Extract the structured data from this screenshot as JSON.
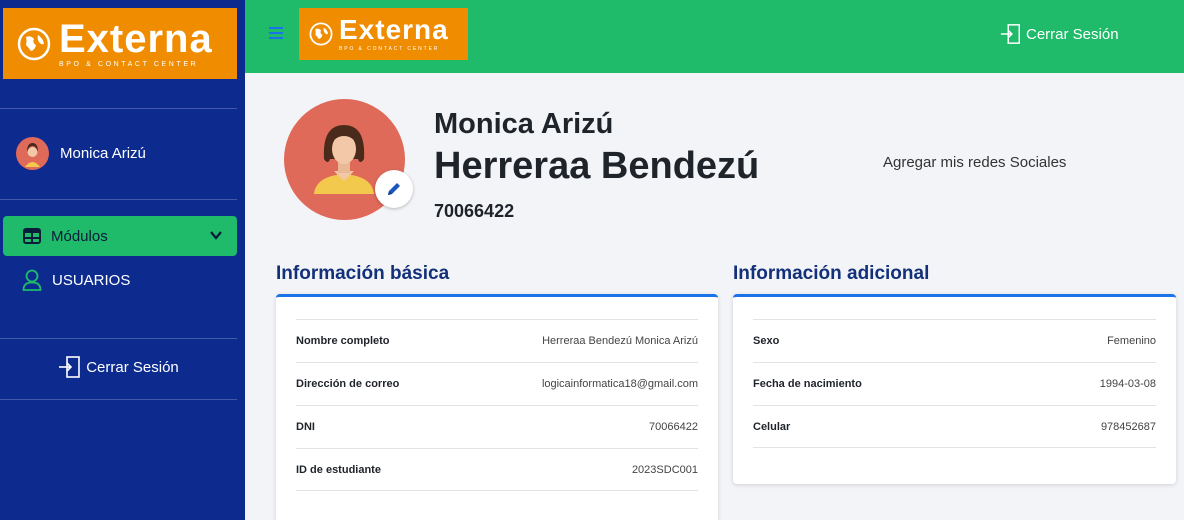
{
  "brand": {
    "name": "Externa",
    "tagline": "BPO & CONTACT CENTER"
  },
  "sidebar": {
    "user_name": "Monica Arizú",
    "modules_label": "Módulos",
    "users_label": "USUARIOS",
    "logout_label": "Cerrar Sesión"
  },
  "topbar": {
    "logout_label": "Cerrar Sesión"
  },
  "profile": {
    "first_names": "Monica Arizú",
    "last_names": "Herreraa Bendezú",
    "dni": "70066422",
    "social_link": "Agregar mis redes Sociales"
  },
  "basic_info": {
    "title": "Información básica",
    "rows": [
      {
        "label": "Nombre completo",
        "value": "Herreraa Bendezú Monica Arizú"
      },
      {
        "label": "Dirección de correo",
        "value": "logicainformatica18@gmail.com"
      },
      {
        "label": "DNI",
        "value": "70066422"
      },
      {
        "label": "ID de estudiante",
        "value": "2023SDC001"
      }
    ]
  },
  "additional_info": {
    "title": "Información adicional",
    "rows": [
      {
        "label": "Sexo",
        "value": "Femenino"
      },
      {
        "label": "Fecha de nacimiento",
        "value": "1994-03-08"
      },
      {
        "label": "Celular",
        "value": "978452687"
      }
    ]
  },
  "colors": {
    "sidebar": "#0d2b8f",
    "topbar": "#1fbb6b",
    "brand_orange": "#f08c00",
    "accent_blue": "#1a73e8",
    "avatar_bg": "#e06a5a"
  }
}
